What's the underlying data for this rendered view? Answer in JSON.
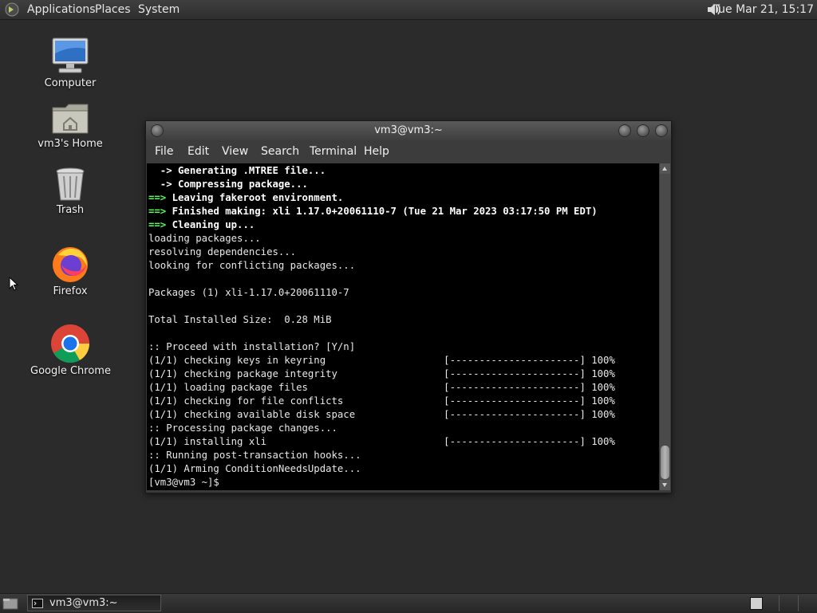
{
  "top_panel": {
    "menus": [
      "Applications",
      "Places",
      "System"
    ],
    "clock": "Tue Mar 21, 15:17"
  },
  "desktop": {
    "icons": [
      {
        "label": "Computer",
        "icon": "computer-icon"
      },
      {
        "label": "vm3's Home",
        "icon": "home-folder-icon"
      },
      {
        "label": "Trash",
        "icon": "trash-icon"
      },
      {
        "label": "Firefox",
        "icon": "firefox-icon"
      },
      {
        "label": "Google Chrome",
        "icon": "chrome-icon"
      }
    ]
  },
  "terminal": {
    "title": "vm3@vm3:~",
    "menu": [
      "File",
      "Edit",
      "View",
      "Search",
      "Terminal",
      "Help"
    ],
    "lines": [
      {
        "t": "  -> Generating .MTREE file...",
        "s": "b"
      },
      {
        "t": "  -> Compressing package...",
        "s": "b"
      },
      {
        "t": "==> Leaving fakeroot environment.",
        "s": "gb"
      },
      {
        "t": "==> Finished making: xli 1.17.0+20061110-7 (Tue 21 Mar 2023 03:17:50 PM EDT)",
        "s": "gb"
      },
      {
        "t": "==> Cleaning up...",
        "s": "gb"
      },
      {
        "t": "loading packages...",
        "s": ""
      },
      {
        "t": "resolving dependencies...",
        "s": ""
      },
      {
        "t": "looking for conflicting packages...",
        "s": ""
      },
      {
        "t": "",
        "s": ""
      },
      {
        "t": "Packages (1) xli-1.17.0+20061110-7",
        "s": ""
      },
      {
        "t": "",
        "s": ""
      },
      {
        "t": "Total Installed Size:  0.28 MiB",
        "s": ""
      },
      {
        "t": "",
        "s": ""
      },
      {
        "t": ":: Proceed with installation? [Y/n]",
        "s": ""
      },
      {
        "t": "(1/1) checking keys in keyring                    [----------------------] 100%",
        "s": ""
      },
      {
        "t": "(1/1) checking package integrity                  [----------------------] 100%",
        "s": ""
      },
      {
        "t": "(1/1) loading package files                       [----------------------] 100%",
        "s": ""
      },
      {
        "t": "(1/1) checking for file conflicts                 [----------------------] 100%",
        "s": ""
      },
      {
        "t": "(1/1) checking available disk space               [----------------------] 100%",
        "s": ""
      },
      {
        "t": ":: Processing package changes...",
        "s": ""
      },
      {
        "t": "(1/1) installing xli                              [----------------------] 100%",
        "s": ""
      },
      {
        "t": ":: Running post-transaction hooks...",
        "s": ""
      },
      {
        "t": "(1/1) Arming ConditionNeedsUpdate...",
        "s": ""
      },
      {
        "t": "[vm3@vm3 ~]$ ",
        "s": ""
      }
    ]
  },
  "taskbar": {
    "tasks": [
      {
        "label": "vm3@vm3:~",
        "icon": "terminal-icon"
      }
    ]
  },
  "colors": {
    "desktop_bg": "#2b2b2b",
    "terminal_bg": "#000000",
    "prompt_arrow_green": "#55ff55"
  }
}
